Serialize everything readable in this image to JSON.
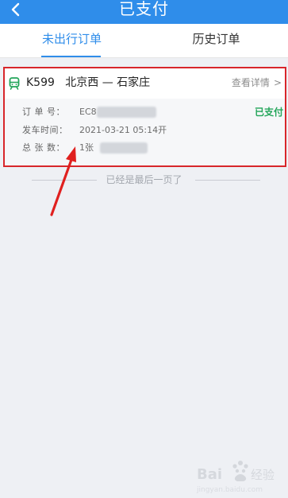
{
  "header": {
    "title": "已支付",
    "back_icon": "chevron-left-icon"
  },
  "tabs": [
    {
      "label": "未出行订单",
      "active": true
    },
    {
      "label": "历史订单",
      "active": false
    }
  ],
  "order": {
    "train_number": "K599",
    "route": "北京西 — 石家庄",
    "details_label": "查看详情",
    "status": "已支付",
    "fields": {
      "order_no": {
        "label": "订 单 号：",
        "value": "EC8"
      },
      "departure": {
        "label": "发车时间：",
        "value": "2021-03-21   05:14开"
      },
      "tickets": {
        "label": "总 张 数：",
        "value": "1张"
      }
    }
  },
  "list_end_text": "已经是最后一页了",
  "colors": {
    "header_bg": "#2f8dea",
    "accent": "#2f8dea",
    "paid_status": "#23a55a",
    "highlight_border": "#d8262b"
  },
  "watermark": "Bai经验"
}
